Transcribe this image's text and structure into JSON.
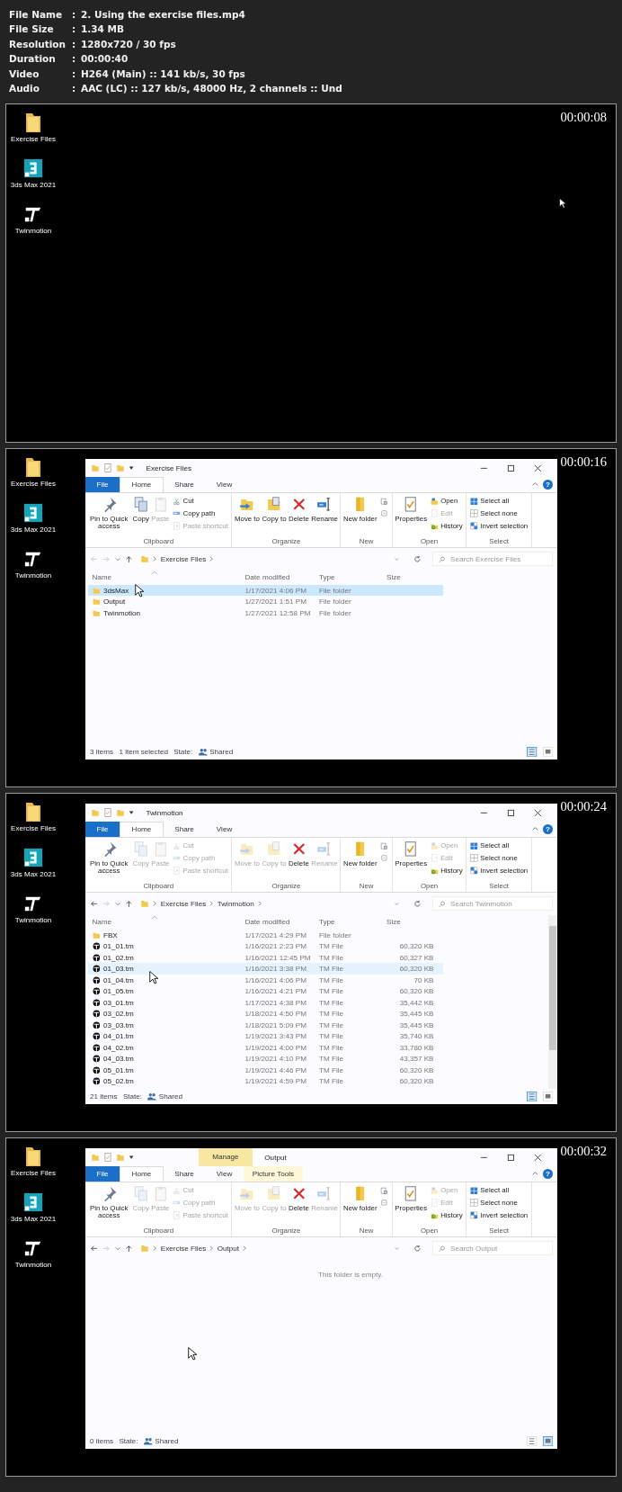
{
  "file_info": [
    {
      "label": "File Name",
      "sep": ":",
      "value": "2. Using the exercise files.mp4"
    },
    {
      "label": "File Size",
      "sep": ":",
      "value": "1.34 MB"
    },
    {
      "label": "Resolution",
      "sep": ":",
      "value": "1280x720 / 30 fps"
    },
    {
      "label": "Duration",
      "sep": ":",
      "value": "00:00:40"
    },
    {
      "label": "Video",
      "sep": ":",
      "value": "H264 (Main) :: 141 kb/s, 30 fps"
    },
    {
      "label": "Audio",
      "sep": ":",
      "value": "AAC (LC) :: 127 kb/s, 48000 Hz, 2 channels :: Und"
    }
  ],
  "frames": [
    {
      "timestamp": "00:00:08",
      "desktop_icons": [
        {
          "label": "Exercise Files",
          "kind": "folder"
        },
        {
          "label": "3ds Max 2021",
          "kind": "max"
        },
        {
          "label": "Twinmotion",
          "kind": "twinmotion"
        }
      ]
    },
    {
      "timestamp": "00:00:16",
      "desktop_icons": [
        {
          "label": "Exercise Files",
          "kind": "folder"
        },
        {
          "label": "3ds Max 2021",
          "kind": "max"
        },
        {
          "label": "Twinmotion",
          "kind": "twinmotion"
        }
      ],
      "explorer": {
        "title": "Exercise Files",
        "tabs": [
          {
            "label": "File",
            "kind": "file",
            "selected": false
          },
          {
            "label": "Home",
            "kind": "tab",
            "selected": true
          },
          {
            "label": "Share",
            "kind": "tab",
            "selected": false
          },
          {
            "label": "View",
            "kind": "tab",
            "selected": false
          }
        ],
        "help": "?",
        "ribbon": [
          {
            "label": "Clipboard",
            "buttons": [
              {
                "label": "Pin to Quick access",
                "kind": "large",
                "disabled": false
              },
              {
                "label": "Copy",
                "kind": "large",
                "disabled": false
              },
              {
                "label": "Paste",
                "kind": "large",
                "disabled": true
              },
              {
                "label": "Cut",
                "kind": "small",
                "disabled": false
              },
              {
                "label": "Copy path",
                "kind": "small",
                "disabled": false
              },
              {
                "label": "Paste shortcut",
                "kind": "small",
                "disabled": true
              }
            ]
          },
          {
            "label": "Organize",
            "buttons": [
              {
                "label": "Move to",
                "kind": "large",
                "disabled": false
              },
              {
                "label": "Copy to",
                "kind": "large",
                "disabled": false
              },
              {
                "label": "Delete",
                "kind": "large",
                "disabled": false
              },
              {
                "label": "Rename",
                "kind": "large",
                "disabled": false
              }
            ]
          },
          {
            "label": "New",
            "buttons": [
              {
                "label": "New folder",
                "kind": "large",
                "disabled": false
              },
              {
                "kind": "small",
                "disabled": false
              },
              {
                "kind": "small",
                "disabled": false
              }
            ]
          },
          {
            "label": "Open",
            "buttons": [
              {
                "label": "Properties",
                "kind": "large",
                "disabled": false
              },
              {
                "label": "Open",
                "kind": "small",
                "disabled": false
              },
              {
                "label": "Edit",
                "kind": "small",
                "disabled": true
              },
              {
                "label": "History",
                "kind": "small",
                "disabled": false
              }
            ]
          },
          {
            "label": "Select",
            "buttons": [
              {
                "label": "Select all",
                "kind": "small",
                "disabled": false
              },
              {
                "label": "Select none",
                "kind": "small",
                "disabled": false
              },
              {
                "label": "Invert selection",
                "kind": "small",
                "disabled": false
              }
            ]
          }
        ],
        "back_disabled": true,
        "path": [
          "Exercise Files"
        ],
        "search_placeholder": "Search Exercise Files",
        "columns": [
          "Name",
          "Date modified",
          "Type",
          "Size"
        ],
        "rows": [
          {
            "name": "3dsMax",
            "date": "1/17/2021 4:06 PM",
            "type": "File folder",
            "kind": "folder",
            "selected": true,
            "hovered": false
          },
          {
            "name": "Output",
            "date": "1/27/2021 1:51 PM",
            "type": "File folder",
            "kind": "folder",
            "selected": false,
            "hovered": false
          },
          {
            "name": "Twinmotion",
            "date": "1/27/2021 12:58 PM",
            "type": "File folder",
            "kind": "folder",
            "selected": false,
            "hovered": false
          }
        ],
        "status": [
          "3 items",
          "1 item selected"
        ],
        "state_label": "State:",
        "state_value": "Shared",
        "views": [
          {
            "selected": true
          },
          {
            "selected": false
          }
        ]
      }
    },
    {
      "timestamp": "00:00:24",
      "desktop_icons": [
        {
          "label": "Exercise Files",
          "kind": "folder"
        },
        {
          "label": "3ds Max 2021",
          "kind": "max"
        },
        {
          "label": "Twinmotion",
          "kind": "twinmotion"
        }
      ],
      "explorer": {
        "title": "Twinmotion",
        "tabs": [
          {
            "label": "File",
            "kind": "file",
            "selected": false
          },
          {
            "label": "Home",
            "kind": "tab",
            "selected": true
          },
          {
            "label": "Share",
            "kind": "tab",
            "selected": false
          },
          {
            "label": "View",
            "kind": "tab",
            "selected": false
          }
        ],
        "help": "?",
        "ribbon": [
          {
            "label": "Clipboard",
            "buttons": [
              {
                "label": "Pin to Quick access",
                "kind": "large",
                "disabled": false
              },
              {
                "label": "Copy",
                "kind": "large",
                "disabled": true
              },
              {
                "label": "Paste",
                "kind": "large",
                "disabled": true
              },
              {
                "label": "Cut",
                "kind": "small",
                "disabled": true
              },
              {
                "label": "Copy path",
                "kind": "small",
                "disabled": true
              },
              {
                "label": "Paste shortcut",
                "kind": "small",
                "disabled": true
              }
            ]
          },
          {
            "label": "Organize",
            "buttons": [
              {
                "label": "Move to",
                "kind": "large",
                "disabled": true
              },
              {
                "label": "Copy to",
                "kind": "large",
                "disabled": true
              },
              {
                "label": "Delete",
                "kind": "large",
                "disabled": false
              },
              {
                "label": "Rename",
                "kind": "large",
                "disabled": true
              }
            ]
          },
          {
            "label": "New",
            "buttons": [
              {
                "label": "New folder",
                "kind": "large",
                "disabled": false
              },
              {
                "kind": "small",
                "disabled": false
              },
              {
                "kind": "small",
                "disabled": false
              }
            ]
          },
          {
            "label": "Open",
            "buttons": [
              {
                "label": "Properties",
                "kind": "large",
                "disabled": false
              },
              {
                "label": "Open",
                "kind": "small",
                "disabled": true
              },
              {
                "label": "Edit",
                "kind": "small",
                "disabled": true
              },
              {
                "label": "History",
                "kind": "small",
                "disabled": false
              }
            ]
          },
          {
            "label": "Select",
            "buttons": [
              {
                "label": "Select all",
                "kind": "small",
                "disabled": false
              },
              {
                "label": "Select none",
                "kind": "small",
                "disabled": false
              },
              {
                "label": "Invert selection",
                "kind": "small",
                "disabled": false
              }
            ]
          }
        ],
        "back_disabled": false,
        "path": [
          "Exercise Files",
          "Twinmotion"
        ],
        "search_placeholder": "Search Twinmotion",
        "columns": [
          "Name",
          "Date modified",
          "Type",
          "Size"
        ],
        "rows": [
          {
            "name": "FBX",
            "date": "1/17/2021 4:29 PM",
            "type": "File folder",
            "kind": "folder",
            "selected": false,
            "hovered": false
          },
          {
            "name": "01_01.tm",
            "date": "1/16/2021 2:23 PM",
            "type": "TM File",
            "size": "60,320 KB",
            "kind": "tm",
            "selected": false,
            "hovered": false
          },
          {
            "name": "01_02.tm",
            "date": "1/16/2021 12:45 PM",
            "type": "TM File",
            "size": "60,327 KB",
            "kind": "tm",
            "selected": false,
            "hovered": false
          },
          {
            "name": "01_03.tm",
            "date": "1/16/2021 3:38 PM",
            "type": "TM File",
            "size": "60,320 KB",
            "kind": "tm",
            "selected": false,
            "hovered": true
          },
          {
            "name": "01_04.tm",
            "date": "1/16/2021 4:06 PM",
            "type": "TM File",
            "size": "70 KB",
            "kind": "tm",
            "selected": false,
            "hovered": false
          },
          {
            "name": "01_05.tm",
            "date": "1/16/2021 4:21 PM",
            "type": "TM File",
            "size": "60,320 KB",
            "kind": "tm",
            "selected": false,
            "hovered": false
          },
          {
            "name": "03_01.tm",
            "date": "1/17/2021 4:38 PM",
            "type": "TM File",
            "size": "35,442 KB",
            "kind": "tm",
            "selected": false,
            "hovered": false
          },
          {
            "name": "03_02.tm",
            "date": "1/18/2021 4:50 PM",
            "type": "TM File",
            "size": "35,445 KB",
            "kind": "tm",
            "selected": false,
            "hovered": false
          },
          {
            "name": "03_03.tm",
            "date": "1/18/2021 5:09 PM",
            "type": "TM File",
            "size": "35,445 KB",
            "kind": "tm",
            "selected": false,
            "hovered": false
          },
          {
            "name": "04_01.tm",
            "date": "1/19/2021 3:43 PM",
            "type": "TM File",
            "size": "35,740 KB",
            "kind": "tm",
            "selected": false,
            "hovered": false
          },
          {
            "name": "04_02.tm",
            "date": "1/19/2021 4:00 PM",
            "type": "TM File",
            "size": "33,780 KB",
            "kind": "tm",
            "selected": false,
            "hovered": false
          },
          {
            "name": "04_03.tm",
            "date": "1/19/2021 4:10 PM",
            "type": "TM File",
            "size": "43,357 KB",
            "kind": "tm",
            "selected": false,
            "hovered": false
          },
          {
            "name": "05_01.tm",
            "date": "1/19/2021 4:46 PM",
            "type": "TM File",
            "size": "60,320 KB",
            "kind": "tm",
            "selected": false,
            "hovered": false
          },
          {
            "name": "05_02.tm",
            "date": "1/19/2021 4:59 PM",
            "type": "TM File",
            "size": "60,320 KB",
            "kind": "tm",
            "selected": false,
            "hovered": false
          }
        ],
        "scrollable": true,
        "status": [
          "21 items"
        ],
        "state_label": "State:",
        "state_value": "Shared",
        "views": [
          {
            "selected": true
          },
          {
            "selected": false
          }
        ]
      }
    },
    {
      "timestamp": "00:00:32",
      "desktop_icons": [
        {
          "label": "Exercise Files",
          "kind": "folder"
        },
        {
          "label": "3ds Max 2021",
          "kind": "max"
        },
        {
          "label": "Twinmotion",
          "kind": "twinmotion"
        }
      ],
      "explorer": {
        "title": "Output",
        "context_header": "Manage",
        "tabs": [
          {
            "label": "File",
            "kind": "file",
            "selected": false
          },
          {
            "label": "Home",
            "kind": "tab",
            "selected": true
          },
          {
            "label": "Share",
            "kind": "tab",
            "selected": false
          },
          {
            "label": "View",
            "kind": "tab",
            "selected": false
          },
          {
            "label": "Picture Tools",
            "kind": "context",
            "selected": false
          }
        ],
        "help": "?",
        "ribbon": [
          {
            "label": "Clipboard",
            "buttons": [
              {
                "label": "Pin to Quick access",
                "kind": "large",
                "disabled": false
              },
              {
                "label": "Copy",
                "kind": "large",
                "disabled": true
              },
              {
                "label": "Paste",
                "kind": "large",
                "disabled": true
              },
              {
                "label": "Cut",
                "kind": "small",
                "disabled": true
              },
              {
                "label": "Copy path",
                "kind": "small",
                "disabled": true
              },
              {
                "label": "Paste shortcut",
                "kind": "small",
                "disabled": true
              }
            ]
          },
          {
            "label": "Organize",
            "buttons": [
              {
                "label": "Move to",
                "kind": "large",
                "disabled": true
              },
              {
                "label": "Copy to",
                "kind": "large",
                "disabled": true
              },
              {
                "label": "Delete",
                "kind": "large",
                "disabled": false
              },
              {
                "label": "Rename",
                "kind": "large",
                "disabled": true
              }
            ]
          },
          {
            "label": "New",
            "buttons": [
              {
                "label": "New folder",
                "kind": "large",
                "disabled": false
              },
              {
                "kind": "small",
                "disabled": false
              },
              {
                "kind": "small",
                "disabled": false
              }
            ]
          },
          {
            "label": "Open",
            "buttons": [
              {
                "label": "Properties",
                "kind": "large",
                "disabled": false
              },
              {
                "label": "Open",
                "kind": "small",
                "disabled": true
              },
              {
                "label": "Edit",
                "kind": "small",
                "disabled": true
              },
              {
                "label": "History",
                "kind": "small",
                "disabled": false
              }
            ]
          },
          {
            "label": "Select",
            "buttons": [
              {
                "label": "Select all",
                "kind": "small",
                "disabled": false
              },
              {
                "label": "Select none",
                "kind": "small",
                "disabled": false
              },
              {
                "label": "Invert selection",
                "kind": "small",
                "disabled": false
              }
            ]
          }
        ],
        "back_disabled": false,
        "path": [
          "Exercise Files",
          "Output"
        ],
        "search_placeholder": "Search Output",
        "empty_message": "This folder is empty.",
        "status": [
          "0 items"
        ],
        "state_label": "State:",
        "state_value": "Shared",
        "views": [
          {
            "selected": false
          },
          {
            "selected": true
          }
        ]
      }
    }
  ]
}
